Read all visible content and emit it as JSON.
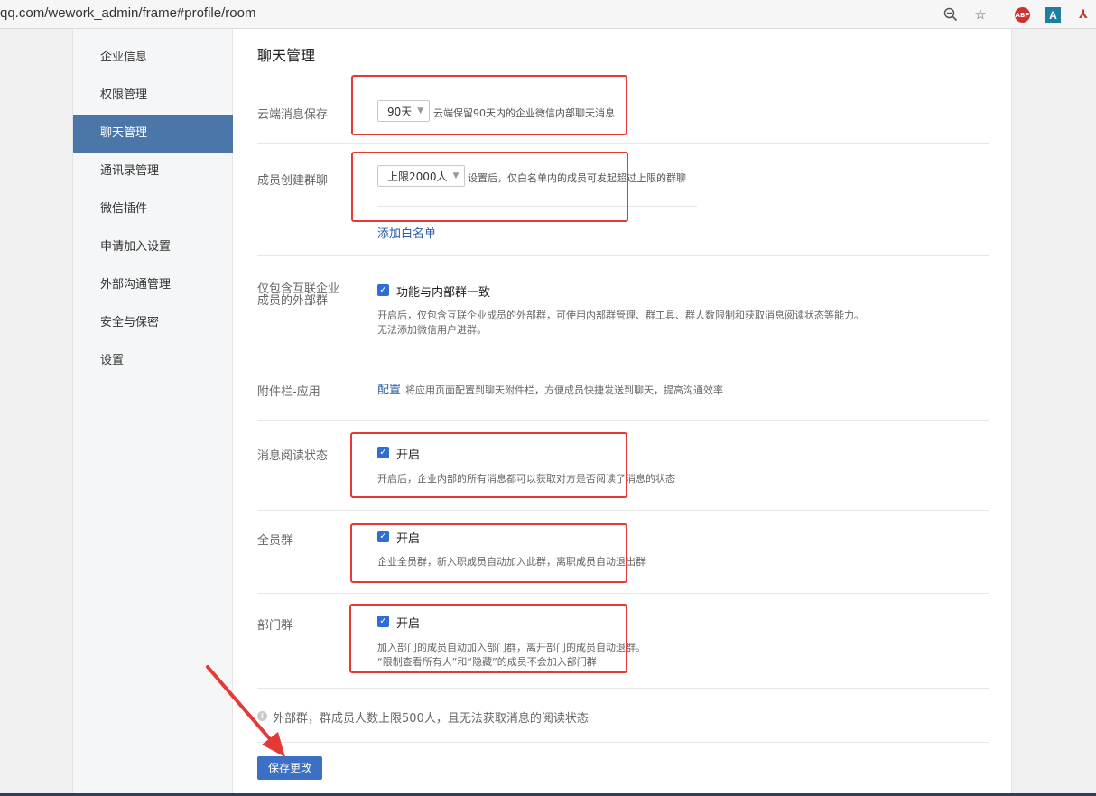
{
  "browser": {
    "url": "qq.com/wework_admin/frame#profile/room",
    "icons": [
      "zoom-icon",
      "star-icon",
      "adblock-icon",
      "translate-icon",
      "pdf-icon"
    ],
    "abp_label": "ABP",
    "a_label": "A"
  },
  "sidebar": {
    "items": [
      {
        "label": "企业信息"
      },
      {
        "label": "权限管理"
      },
      {
        "label": "聊天管理",
        "active": true
      },
      {
        "label": "通讯录管理"
      },
      {
        "label": "微信插件"
      },
      {
        "label": "申请加入设置"
      },
      {
        "label": "外部沟通管理"
      },
      {
        "label": "安全与保密"
      },
      {
        "label": "设置"
      }
    ],
    "active_color": "#4a76a8"
  },
  "main": {
    "title": "聊天管理",
    "cloud": {
      "label": "云端消息保存",
      "select_value": "90天",
      "hint": "云端保留90天内的企业微信内部聊天消息"
    },
    "group_create": {
      "label": "成员创建群聊",
      "select_value": "上限2000人",
      "hint": "设置后，仅白名单内的成员可发起超过上限的群聊",
      "whitelist_link": "添加白名单"
    },
    "interconnect": {
      "label_line1": "仅包含互联企业",
      "label_line2": "成员的外部群",
      "checkbox_label": "功能与内部群一致",
      "checked": true,
      "desc_line1": "开启后，仅包含互联企业成员的外部群，可使用内部群管理、群工具、群人数限制和获取消息阅读状态等能力。",
      "desc_line2": "无法添加微信用户进群。"
    },
    "attachment": {
      "label": "附件栏-应用",
      "link": "配置",
      "hint": "将应用页面配置到聊天附件栏，方便成员快捷发送到聊天，提高沟通效率"
    },
    "read_status": {
      "label": "消息阅读状态",
      "checkbox_label": "开启",
      "checked": true,
      "desc": "开启后，企业内部的所有消息都可以获取对方是否阅读了消息的状态"
    },
    "all_group": {
      "label": "全员群",
      "checkbox_label": "开启",
      "checked": true,
      "desc": "企业全员群，新入职成员自动加入此群，离职成员自动退出群"
    },
    "dept_group": {
      "label": "部门群",
      "checkbox_label": "开启",
      "checked": true,
      "desc_line1": "加入部门的成员自动加入部门群，离开部门的成员自动退群。",
      "desc_line2": "“限制查看所有人”和“隐藏”的成员不会加入部门群"
    },
    "note": "外部群，群成员人数上限500人，且无法获取消息的阅读状态",
    "save_label": "保存更改"
  },
  "colors": {
    "checkbox": "#2e6ed3",
    "link": "#2b5ea6",
    "save_button": "#3b70c4",
    "annotation_red": "#e53935"
  }
}
